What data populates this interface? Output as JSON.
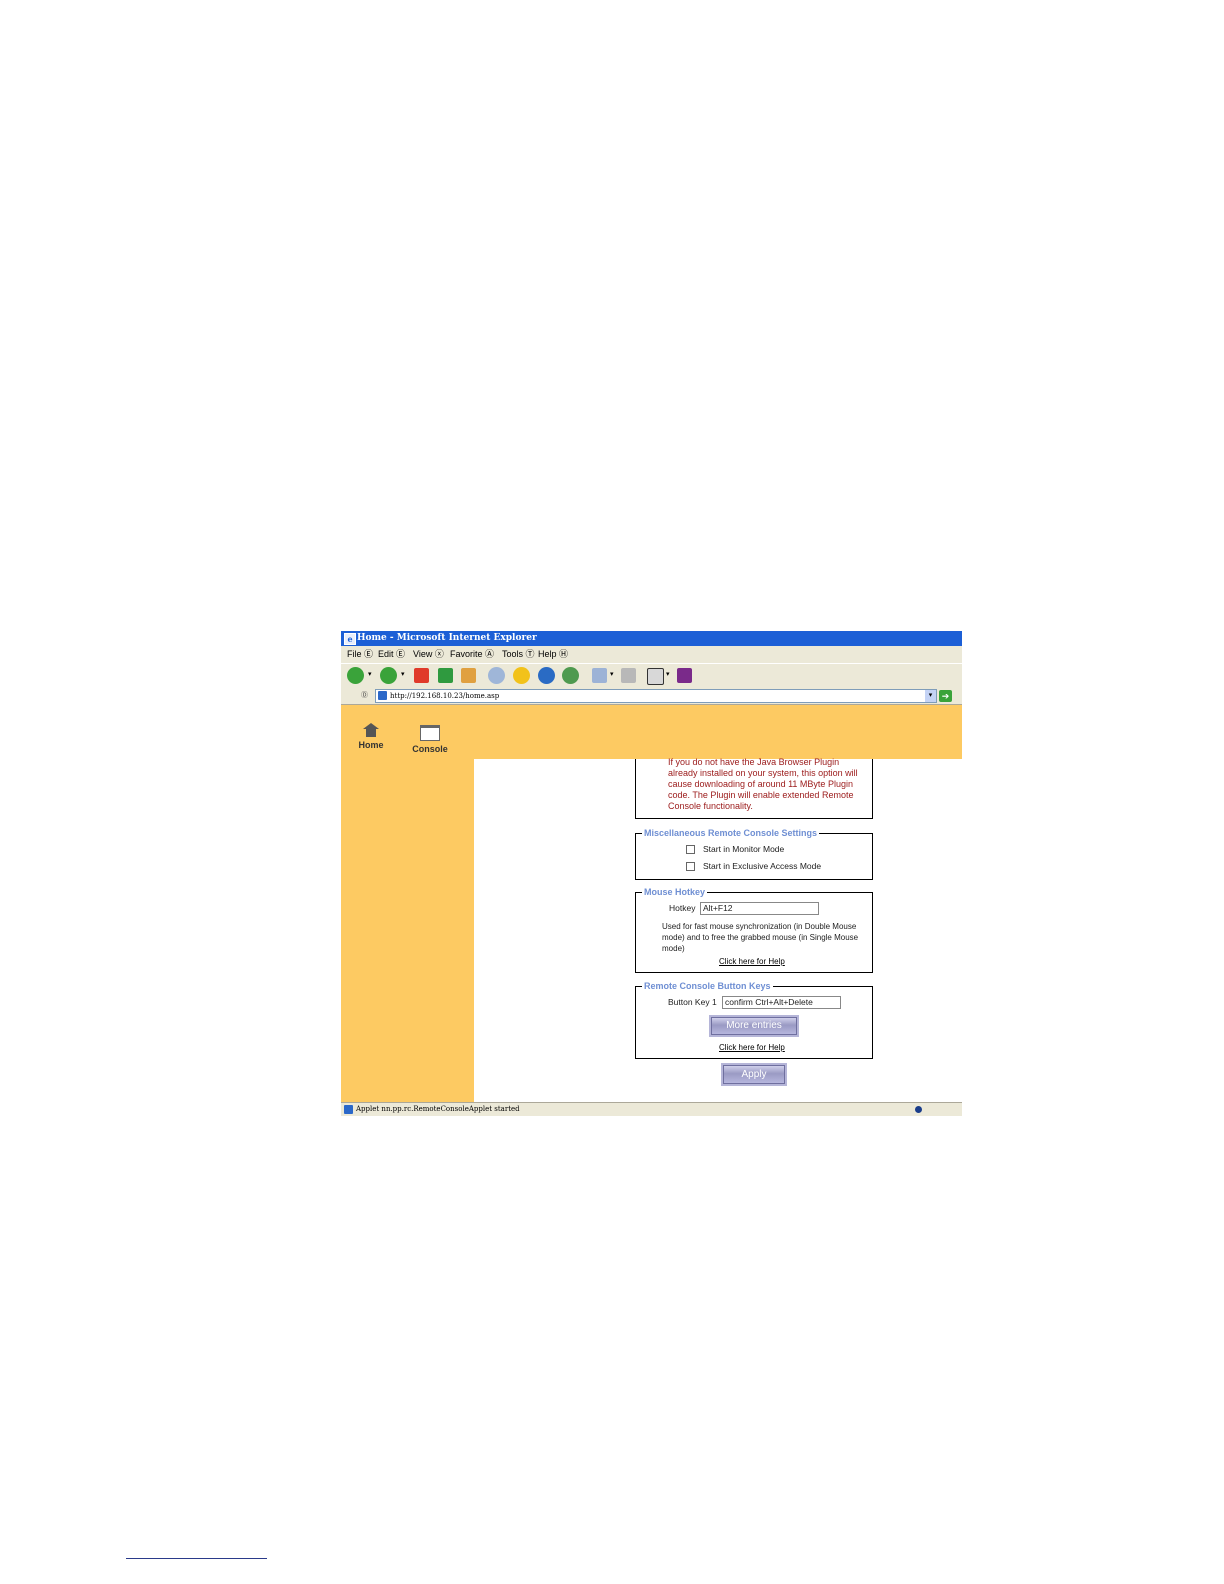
{
  "window": {
    "title": "Home - Microsoft Internet Explorer"
  },
  "menu": [
    "File Ⓔ",
    "Edit Ⓔ",
    "View ⓧ",
    "Favorite Ⓐ",
    "Tools Ⓣ",
    "Help Ⓗ"
  ],
  "address": {
    "url": "http://192.168.10.23/home.asp",
    "label": "Ⓓ"
  },
  "nav": {
    "home": "Home",
    "console": "Console"
  },
  "plugin_note": "If you do not have the Java Browser Plugin already installed on your system, this option will cause downloading of around 11 MByte Plugin code. The Plugin will enable extended Remote Console functionality.",
  "misc": {
    "legend": "Miscellaneous Remote Console Settings",
    "monitor_mode": "Start in Monitor Mode",
    "exclusive_mode": "Start in Exclusive Access Mode"
  },
  "hotkey": {
    "legend": "Mouse Hotkey",
    "label": "Hotkey",
    "value": "Alt+F12",
    "description": "Used for fast mouse synchronization (in Double Mouse mode) and to free the grabbed mouse (in Single Mouse mode)",
    "help": "Click here for Help"
  },
  "button_keys": {
    "legend": "Remote Console Button Keys",
    "label": "Button Key 1",
    "value": "confirm Ctrl+Alt+Delete",
    "more": "More entries",
    "help": "Click here for Help"
  },
  "apply": "Apply",
  "status": {
    "text": "Applet nn.pp.rc.RemoteConsoleApplet started"
  },
  "colors": {
    "accent_band": "#fdca62",
    "legend": "#6f8fd3",
    "note_red": "#9b1a1a",
    "titlebar": "#1c5fd6"
  }
}
